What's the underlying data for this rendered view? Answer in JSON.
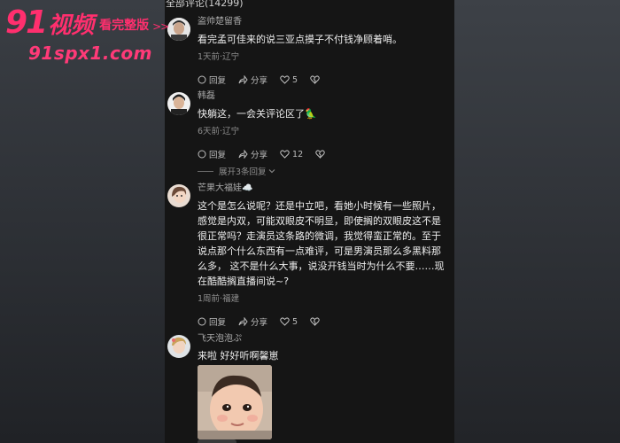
{
  "watermark": {
    "logo_num": "91",
    "logo_cn": "视频",
    "tag": "看完整版",
    "arrows": ">>",
    "url": "91spx1.com"
  },
  "list": {
    "header": "全部评论(14299)"
  },
  "comments": [
    {
      "user": "盗帅楚留香",
      "text": "看完孟可佳来的说三亚点摸子不付钱净顾着哨。",
      "meta": "1天前·辽宁",
      "reply_label": "回复",
      "share_label": "分享",
      "likes": "5"
    },
    {
      "user": "韩磊",
      "text": "快躺这，一会关评论区了🦜",
      "meta": "6天前·辽宁",
      "reply_label": "回复",
      "share_label": "分享",
      "likes": "12",
      "expand": "展开3条回复"
    },
    {
      "user": "芒果大福娃☁️",
      "text": "这个是怎么说呢？还是中立吧，看她小时候有一些照片，感觉是内双，可能双眼皮不明显，即使搁的双眼皮这不是很正常吗？走演员这条路的微调，我觉得蛮正常的。至于说点那个什么东西有一点难评，可是男演员那么多黑料那么多，   这不是什么大事，说没开钱当时为什么不要……现在酷酷搁直播间说~?",
      "meta": "1周前·福建",
      "reply_label": "回复",
      "share_label": "分享",
      "likes": "5"
    },
    {
      "user": "飞天泡泡ぷ",
      "text": "来啦  好好听啊馨崽"
    }
  ],
  "colors": {
    "watermark": "#ff2f6e",
    "panel": "#151515",
    "text": "#eeeeee",
    "muted": "#8e8e8e"
  }
}
